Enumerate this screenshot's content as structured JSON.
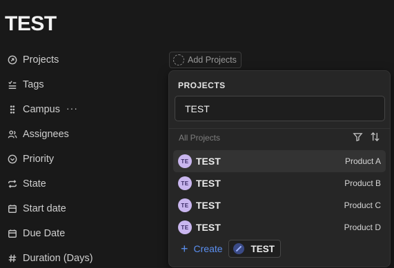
{
  "page": {
    "title": "TEST"
  },
  "properties": [
    {
      "key": "projects",
      "label": "Projects",
      "icon": "circle-arrow-icon"
    },
    {
      "key": "tags",
      "label": "Tags",
      "icon": "tags-icon"
    },
    {
      "key": "campus",
      "label": "Campus",
      "icon": "drag-handle-icon"
    },
    {
      "key": "assignees",
      "label": "Assignees",
      "icon": "users-icon"
    },
    {
      "key": "priority",
      "label": "Priority",
      "icon": "chevron-circle-icon"
    },
    {
      "key": "state",
      "label": "State",
      "icon": "repeat-icon"
    },
    {
      "key": "start_date",
      "label": "Start date",
      "icon": "calendar-icon"
    },
    {
      "key": "due_date",
      "label": "Due Date",
      "icon": "calendar-icon"
    },
    {
      "key": "duration",
      "label": "Duration (Days)",
      "icon": "hash-icon"
    }
  ],
  "campus_more": "···",
  "add_projects": {
    "label": "Add Projects",
    "icon": "dashed-circle-icon"
  },
  "dropdown": {
    "heading": "PROJECTS",
    "search_value": "TEST",
    "subheading": "All Projects",
    "tools": [
      "filter-icon",
      "sort-icon"
    ],
    "items": [
      {
        "avatar": "TE",
        "name": "TEST",
        "group": "Product A",
        "active": true
      },
      {
        "avatar": "TE",
        "name": "TEST",
        "group": "Product B",
        "active": false
      },
      {
        "avatar": "TE",
        "name": "TEST",
        "group": "Product C",
        "active": false
      },
      {
        "avatar": "TE",
        "name": "TEST",
        "group": "Product D",
        "active": false
      }
    ],
    "create_label": "Create",
    "create_value": "TEST"
  },
  "colors": {
    "accent": "#5b8ff0",
    "avatar_bg": "#c9b6ef",
    "background": "#191919"
  }
}
